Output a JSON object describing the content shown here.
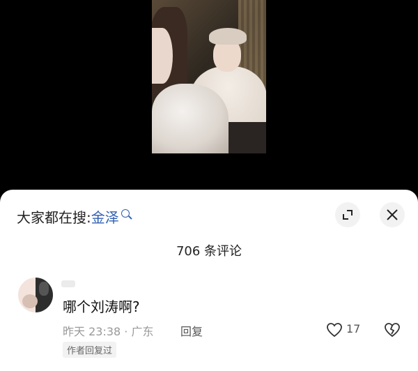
{
  "search_hint": {
    "prefix": "大家都在搜:",
    "keyword": "金泽"
  },
  "comments_count_label": "706 条评论",
  "comment": {
    "text": "哪个刘涛啊?",
    "time_location": "昨天 23:38 · 广东",
    "reply_label": "回复",
    "like_count": "17",
    "author_badge": "作者回复过"
  },
  "icons": {
    "search": "search-icon",
    "expand": "expand-icon",
    "close": "close-icon",
    "like": "heart-icon",
    "dislike": "broken-heart-icon"
  },
  "colors": {
    "keyword": "#2f5fb3",
    "sheet_background": "#ffffff",
    "video_background": "#000000"
  }
}
